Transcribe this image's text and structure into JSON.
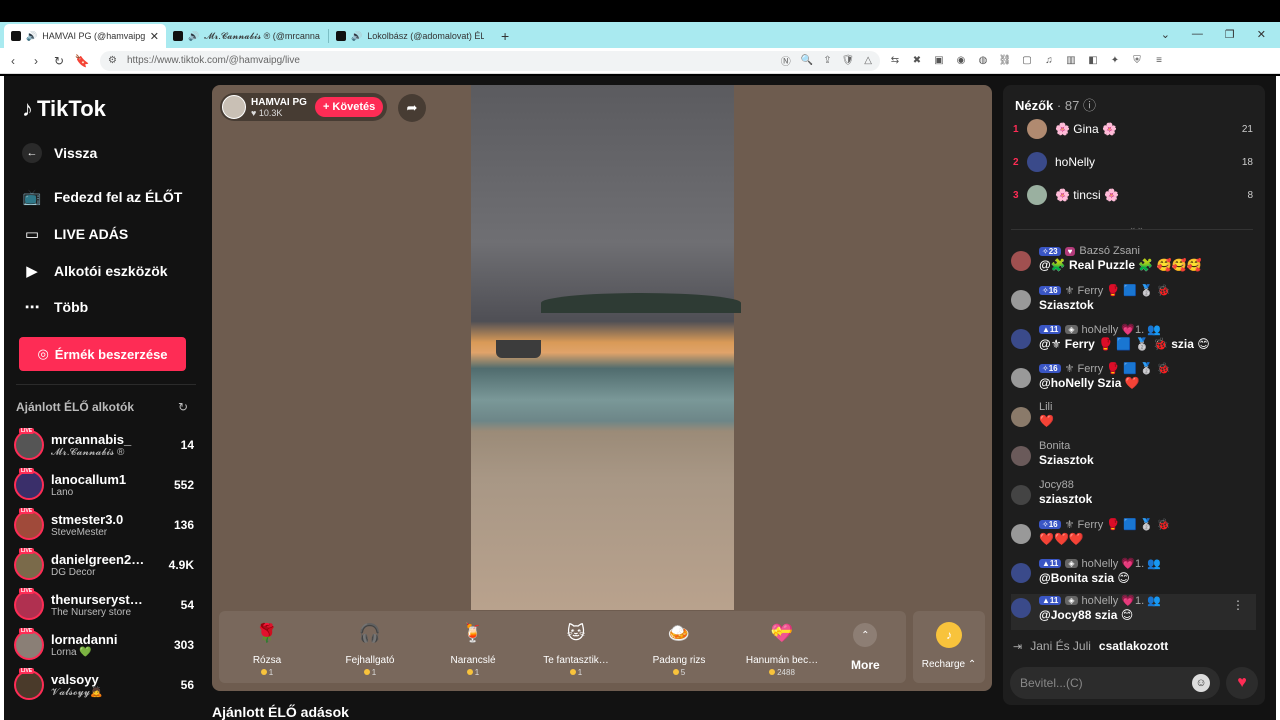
{
  "browser": {
    "tabs": [
      {
        "title": "HAMVAI PG (@hamvaipg) ÉL…",
        "active": true
      },
      {
        "title": "𝓜𝓻.𝓒𝓪𝓷𝓷𝓪𝓫𝓲𝓼 ® (@mrcanna…",
        "active": false
      },
      {
        "title": "Lokolbász (@adomalovat) ÉLŐ a…",
        "active": false
      }
    ],
    "url": "https://www.tiktok.com/@hamvaipg/live",
    "window_controls": [
      "⌄",
      "—",
      "❐",
      "✕"
    ]
  },
  "sidebar": {
    "logo": "TikTok",
    "back_label": "Vissza",
    "nav": [
      {
        "label": "Fedezd fel az ÉLŐT",
        "icon": "tv-icon"
      },
      {
        "label": "LIVE ADÁS",
        "icon": "camera-icon"
      },
      {
        "label": "Alkotói eszközök",
        "icon": "play-square-icon"
      },
      {
        "label": "Több",
        "icon": "more-icon"
      }
    ],
    "coins_button": "Érmék beszerzése",
    "recommended_title": "Ajánlott ÉLŐ alkotók",
    "live_badge": "LIVE",
    "creators": [
      {
        "name": "mrcannabis_",
        "sub": "𝓜𝓻.𝓒𝓪𝓷𝓷𝓪𝓫𝓲𝓼 ®",
        "count": "14"
      },
      {
        "name": "lanocallum1",
        "sub": "Lano",
        "count": "552"
      },
      {
        "name": "stmester3.0",
        "sub": "SteveMester",
        "count": "136"
      },
      {
        "name": "danielgreen2…",
        "sub": "DG Decor",
        "count": "4.9K"
      },
      {
        "name": "thenurseryst…",
        "sub": "The Nursery store",
        "count": "54"
      },
      {
        "name": "lornadanni",
        "sub": "Lorna 💚",
        "count": "303"
      },
      {
        "name": "valsoyy",
        "sub": "𝓥𝓪𝓵𝓼𝓸𝔂𝔂🙇",
        "count": "56"
      }
    ]
  },
  "stream": {
    "host_name": "HAMVAI PG",
    "host_likes": "♥ 10.3K",
    "follow_label": "+ Követés",
    "gifts": [
      {
        "name": "Rózsa",
        "price": "1",
        "icon": "🌹"
      },
      {
        "name": "Fejhallgató",
        "price": "1",
        "icon": "🎧"
      },
      {
        "name": "Narancslé",
        "price": "1",
        "icon": "🍹"
      },
      {
        "name": "Te fantasztik…",
        "price": "1",
        "icon": "🐱"
      },
      {
        "name": "Padang rizs",
        "price": "5",
        "icon": "🍛"
      },
      {
        "name": "Hanumán bec…",
        "price": "2488",
        "icon": "💝"
      }
    ],
    "more_label": "More",
    "recharge_label": "Recharge ⌃",
    "bottom_heading": "Ajánlott ÉLŐ adások"
  },
  "chat": {
    "viewers_label": "Nézők",
    "viewers_count": "· 87",
    "top_viewers": [
      {
        "rank": "1",
        "name": "🌸 Gina 🌸",
        "score": "21"
      },
      {
        "rank": "2",
        "name": "hoNelly",
        "score": "18"
      },
      {
        "rank": "3",
        "name": "🌸 tincsi 🌸",
        "score": "8"
      }
    ],
    "messages": [
      {
        "badge": "✧23",
        "user": "Bazsó Zsani",
        "text": "@🧩 Real Puzzle 🧩 🥰🥰🥰"
      },
      {
        "badge": "✧16",
        "user": "⚜ Ferry 🥊 🟦 🥈 🐞",
        "text": "Sziasztok"
      },
      {
        "badge": "▲11",
        "user": "hoNelly 💗1. 👥",
        "text": "@⚜ Ferry 🥊 🟦 🥈 🐞 szia 😊"
      },
      {
        "badge": "✧16",
        "user": "⚜ Ferry 🥊 🟦 🥈 🐞",
        "text": "@hoNelly Szia ❤️"
      },
      {
        "badge": "",
        "user": "Lili",
        "text": "❤️"
      },
      {
        "badge": "",
        "user": "Bonita",
        "text": "Sziasztok"
      },
      {
        "badge": "",
        "user": "Jocy88",
        "text": "sziasztok"
      },
      {
        "badge": "✧16",
        "user": "⚜ Ferry 🥊 🟦 🥈 🐞",
        "text": "❤️❤️❤️"
      },
      {
        "badge": "▲11",
        "user": "hoNelly 💗1. 👥",
        "text": "@Bonita szia 😊"
      },
      {
        "badge": "▲11",
        "user": "hoNelly 💗1. 👥",
        "text": "@Jocy88 szia 😊"
      }
    ],
    "joined_name": "Jani És Juli",
    "joined_text": "csatlakozott",
    "input_placeholder": "Bevitel...(C)"
  }
}
